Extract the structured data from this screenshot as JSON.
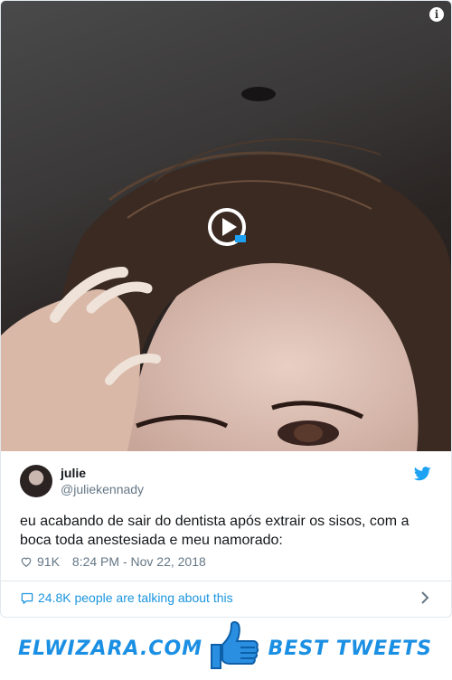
{
  "tweet": {
    "display_name": "julie",
    "handle": "@juliekennady",
    "text": "eu acabando de sair do dentista após extrair os sisos, com a boca toda anestesiada e meu namorado:",
    "likes": "91K",
    "timestamp": "8:24 PM - Nov 22, 2018",
    "talking": "24.8K people are talking about this"
  },
  "media": {
    "info_label": "i",
    "play_icon": "play-icon"
  },
  "icons": {
    "bird": "twitter-bird-icon",
    "heart": "heart-icon",
    "bubble": "speech-bubble-icon",
    "chevron": "chevron-right-icon",
    "thumb": "thumbs-up-icon"
  },
  "footer": {
    "left_brand": "ELWIZARA.COM",
    "right_brand": "BEST TWEETS"
  },
  "colors": {
    "accent": "#1da1f2",
    "link": "#1b95e0",
    "brand": "#1a8fe3",
    "muted": "#657786"
  }
}
